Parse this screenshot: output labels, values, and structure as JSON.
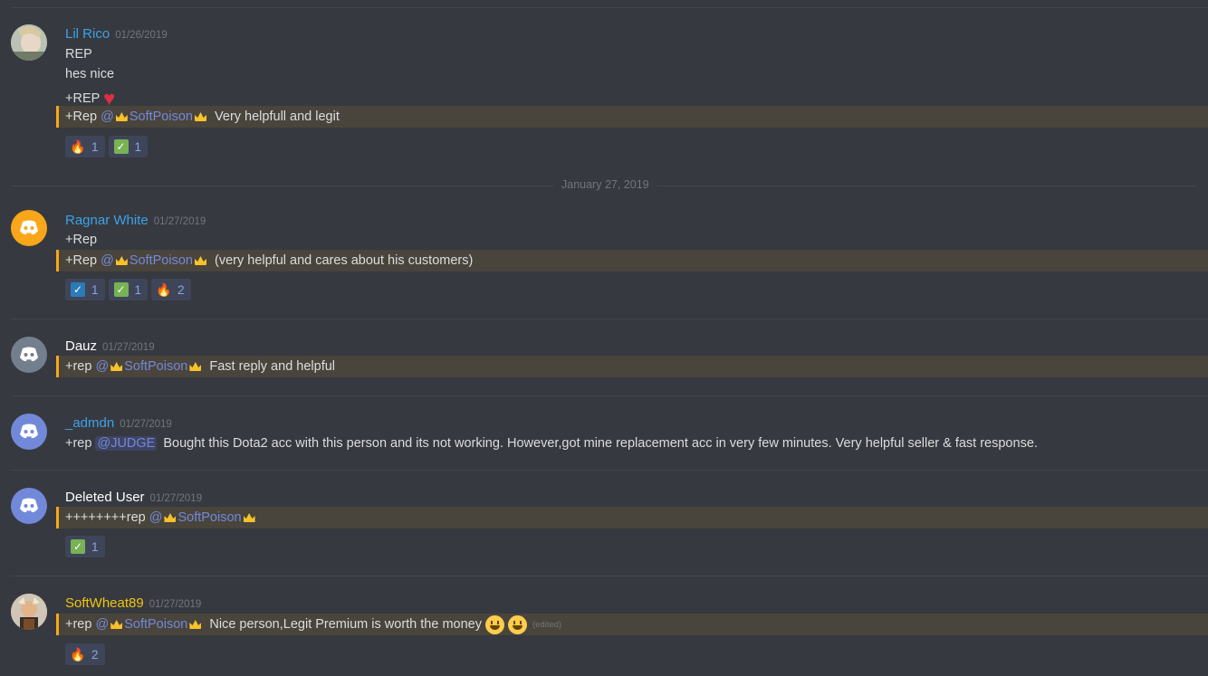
{
  "date_divider": "January 27, 2019",
  "messages": [
    {
      "username": "Lil Rico",
      "timestamp": "01/26/2019",
      "name_color": "#3ea2e8",
      "lines": [
        "REP",
        "hes nice",
        "+REP"
      ],
      "highlight": {
        "prefix": "+Rep",
        "mention": "@",
        "name": "SoftPoison",
        "suffix": "Very helpfull and legit"
      },
      "reactions": [
        {
          "emoji": "flame-icon",
          "count": "1"
        },
        {
          "emoji": "check-box-icon",
          "count": "1"
        }
      ]
    },
    {
      "username": "Ragnar White",
      "timestamp": "01/27/2019",
      "name_color": "#3ea2e8",
      "lines": [
        "+Rep"
      ],
      "highlight": {
        "prefix": "+Rep",
        "mention": "@",
        "name": "SoftPoison",
        "suffix": "(very helpful and cares about his customers)"
      },
      "reactions": [
        {
          "emoji": "blue-check-icon",
          "count": "1"
        },
        {
          "emoji": "check-box-icon",
          "count": "1"
        },
        {
          "emoji": "flame-icon",
          "count": "2"
        }
      ]
    },
    {
      "username": "Dauz",
      "timestamp": "01/27/2019",
      "name_color": "#ffffff",
      "highlight": {
        "prefix": "+rep",
        "mention": "@",
        "name": "SoftPoison",
        "suffix": "Fast reply and helpful"
      }
    },
    {
      "username": "_admdn",
      "timestamp": "01/27/2019",
      "name_color": "#3ea2e8",
      "line": {
        "prefix": "+rep",
        "mention": "@JUDGE",
        "suffix": "Bought this Dota2  acc with this person and its not working. However,got mine replacement acc in very few minutes. Very helpful seller & fast response."
      }
    },
    {
      "username": "Deleted User",
      "timestamp": "01/27/2019",
      "name_color": "#ffffff",
      "highlight": {
        "prefix": "++++++++rep",
        "mention": "@",
        "name": "SoftPoison",
        "suffix": ""
      },
      "reactions": [
        {
          "emoji": "check-box-icon",
          "count": "1"
        }
      ]
    },
    {
      "username": "SoftWheat89",
      "timestamp": "01/27/2019",
      "name_color": "#f1c40f",
      "highlight": {
        "prefix": "+rep",
        "mention": "@",
        "name": "SoftPoison",
        "suffix": "Nice person,Legit Premium is worth the money",
        "edited": "(edited)"
      },
      "reactions": [
        {
          "emoji": "flame-icon",
          "count": "2"
        }
      ]
    }
  ]
}
